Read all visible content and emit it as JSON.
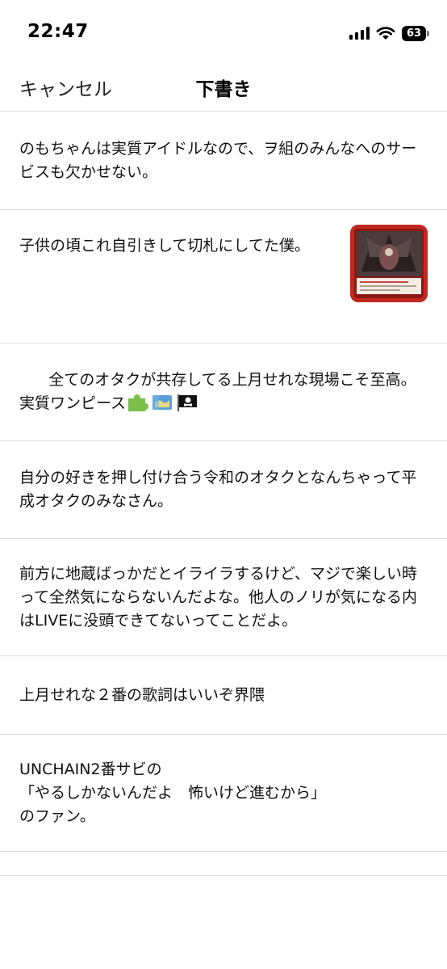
{
  "status_bar": {
    "time": "22:47",
    "battery": "63"
  },
  "nav": {
    "cancel_label": "キャンセル",
    "title": "下書き"
  },
  "drafts": [
    {
      "text": "のもちゃんは実質アイドルなので、ヲ組のみんなへのサービスも欠かせない。"
    },
    {
      "text": "子供の頃これ自引きして切札にしてた僕。",
      "has_image": true
    },
    {
      "text": "全てのオタクが共存してる上月せれな現場こそ至高。実質ワンピース",
      "emojis": [
        "puzzle-piece-emoji",
        "map-emoji",
        "pirate-flag-emoji"
      ]
    },
    {
      "text": "自分の好きを押し付け合う令和のオタクとなんちゃって平成オタクのみなさん。"
    },
    {
      "text": "前方に地蔵ばっかだとイライラするけど、マジで楽しい時って全然気にならないんだよな。他人のノリが気になる内はLIVEに没頭できてないってことだよ。"
    },
    {
      "text": "上月せれな２番の歌詞はいいぞ界隈"
    },
    {
      "text": "UNCHAIN2番サビの\n「やるしかないんだよ　怖いけど進むから」\nのファン。"
    }
  ]
}
